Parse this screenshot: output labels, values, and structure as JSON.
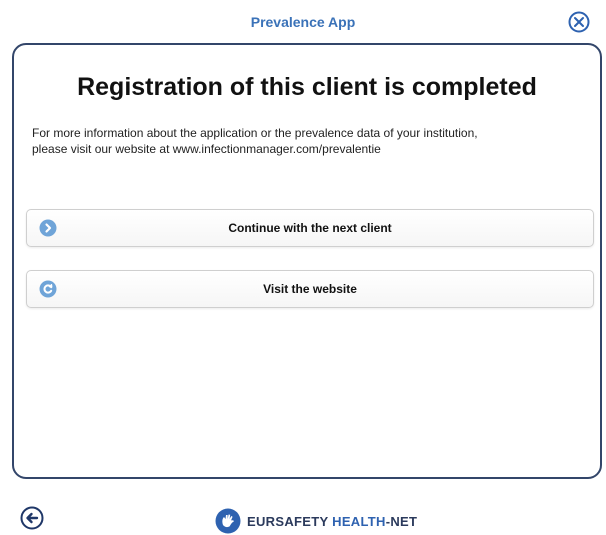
{
  "header": {
    "title": "Prevalence App",
    "close_icon": "close-circle-icon"
  },
  "main": {
    "heading": "Registration of this client is completed",
    "info_line1": "For more information about the application or the prevalence data of your institution,",
    "info_line2": "please visit our website at www.infectionmanager.com/prevalentie",
    "buttons": [
      {
        "label": "Continue with the next client",
        "icon": "arrow-right-circle-icon"
      },
      {
        "label": "Visit the website",
        "icon": "refresh-circle-icon"
      }
    ]
  },
  "footer": {
    "back_icon": "arrow-left-circle-icon",
    "logo_part1": "EURSAFETY",
    "logo_part2": "HEALTH",
    "logo_part3": "-NET"
  },
  "colors": {
    "accent": "#3a72b8",
    "border": "#33466a",
    "icon_fill": "#6fa4d8"
  }
}
